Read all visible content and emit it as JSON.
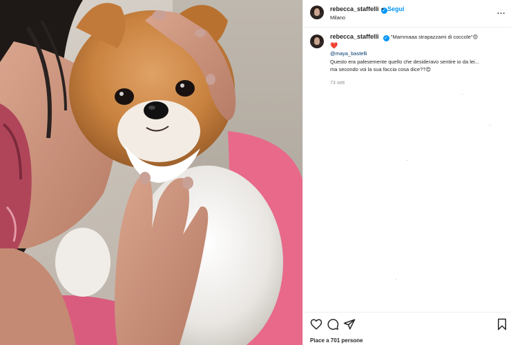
{
  "post": {
    "username": "rebecca_staffelli",
    "follow_label": "Segui",
    "separator": "•",
    "location": "Milano",
    "more_label": "...",
    "caption": {
      "username": "rebecca_staffelli",
      "text": "\"Mammaaa strapazzami di coccole\"😍",
      "heart": "❤️",
      "mention": "@maya_bastelli",
      "line1": "Questo era palesemente quello che desideravo sentire io da lei...",
      "line2": "ma secondo voi la sua faccia cosa dice??😍",
      "timestamp": "73 sett"
    },
    "likes_text": "Piace a 701 persone"
  },
  "icons": {
    "verified": "verified-badge-icon",
    "like": "heart-icon",
    "comment": "comment-icon",
    "share": "paper-plane-icon",
    "save": "bookmark-icon",
    "more": "more-options-icon"
  },
  "colors": {
    "accent": "#0095f6",
    "text": "#262626",
    "muted": "#8e8e8e",
    "mention": "#00376b",
    "heart": "#ed4956",
    "border": "#efefef"
  }
}
